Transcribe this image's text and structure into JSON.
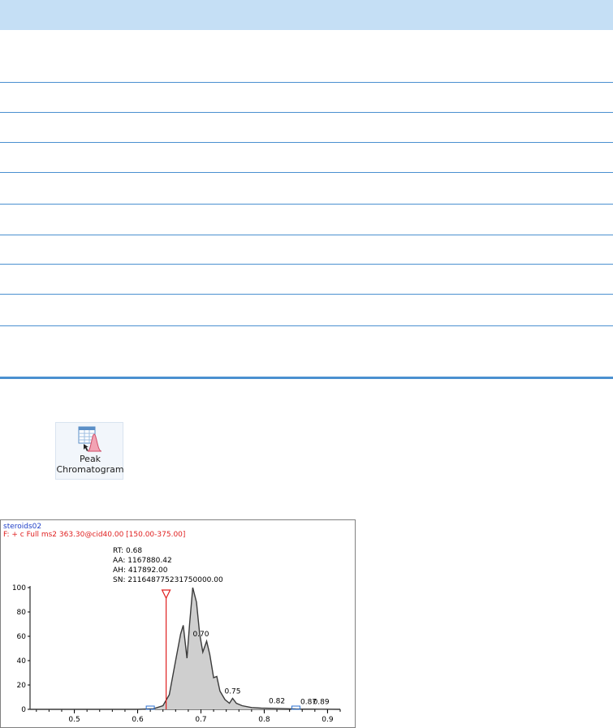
{
  "ribbon": {
    "peak_chromatogram": {
      "line1": "Peak",
      "line2": "Chromatogram"
    }
  },
  "chromatogram": {
    "file_name": "steroids02",
    "filter": "F: + c Full ms2 363.30@cid40.00 [150.00-375.00]",
    "peak_info": {
      "rt": "RT: 0.68",
      "aa": "AA: 1167880.42",
      "ah": "AH: 417892.00",
      "sn": "SN: 211648775231750000.00"
    },
    "colors": {
      "file_name": "#1f3fc8",
      "filter": "#e02020",
      "marker": "#e02020",
      "fill": "#cfcfcf",
      "trace": "#3a3a3a"
    },
    "chart_data": {
      "type": "area",
      "xlim": [
        0.43,
        0.92
      ],
      "ylim": [
        0,
        100
      ],
      "x_ticks": [
        0.5,
        0.6,
        0.7,
        0.8,
        0.9
      ],
      "y_ticks": [
        0,
        20,
        40,
        60,
        80,
        100
      ],
      "x_tick_labels": [
        "0.5",
        "0.6",
        "0.7",
        "0.8",
        "0.9"
      ],
      "y_tick_labels": [
        "0",
        "20",
        "40",
        "60",
        "80",
        "100"
      ],
      "series": [
        {
          "points": [
            [
              0.43,
              0
            ],
            [
              0.6,
              0
            ],
            [
              0.625,
              0.5
            ],
            [
              0.64,
              3
            ],
            [
              0.65,
              12
            ],
            [
              0.66,
              40
            ],
            [
              0.668,
              62
            ],
            [
              0.672,
              69
            ],
            [
              0.678,
              42
            ],
            [
              0.682,
              70
            ],
            [
              0.687,
              100
            ],
            [
              0.693,
              88
            ],
            [
              0.698,
              62
            ],
            [
              0.703,
              47
            ],
            [
              0.709,
              56
            ],
            [
              0.714,
              45
            ],
            [
              0.72,
              26
            ],
            [
              0.725,
              27
            ],
            [
              0.73,
              15
            ],
            [
              0.738,
              8
            ],
            [
              0.745,
              5
            ],
            [
              0.75,
              9
            ],
            [
              0.756,
              5
            ],
            [
              0.765,
              3
            ],
            [
              0.78,
              1.5
            ],
            [
              0.795,
              1
            ],
            [
              0.82,
              0.7
            ],
            [
              0.85,
              0.3
            ],
            [
              0.87,
              0.2
            ],
            [
              0.89,
              0.1
            ],
            [
              0.92,
              0
            ]
          ]
        }
      ],
      "peak_labels": [
        {
          "x": 0.7,
          "y": 56,
          "label": "0.70"
        },
        {
          "x": 0.75,
          "y": 9,
          "label": "0.75"
        },
        {
          "x": 0.82,
          "y": 1,
          "label": "0.82"
        },
        {
          "x": 0.87,
          "y": 0.3,
          "label": "0.87"
        },
        {
          "x": 0.89,
          "y": 0.2,
          "label": "0.89"
        }
      ],
      "marker_x": 0.645,
      "baseline_boxes": [
        0.62,
        0.85
      ]
    }
  }
}
